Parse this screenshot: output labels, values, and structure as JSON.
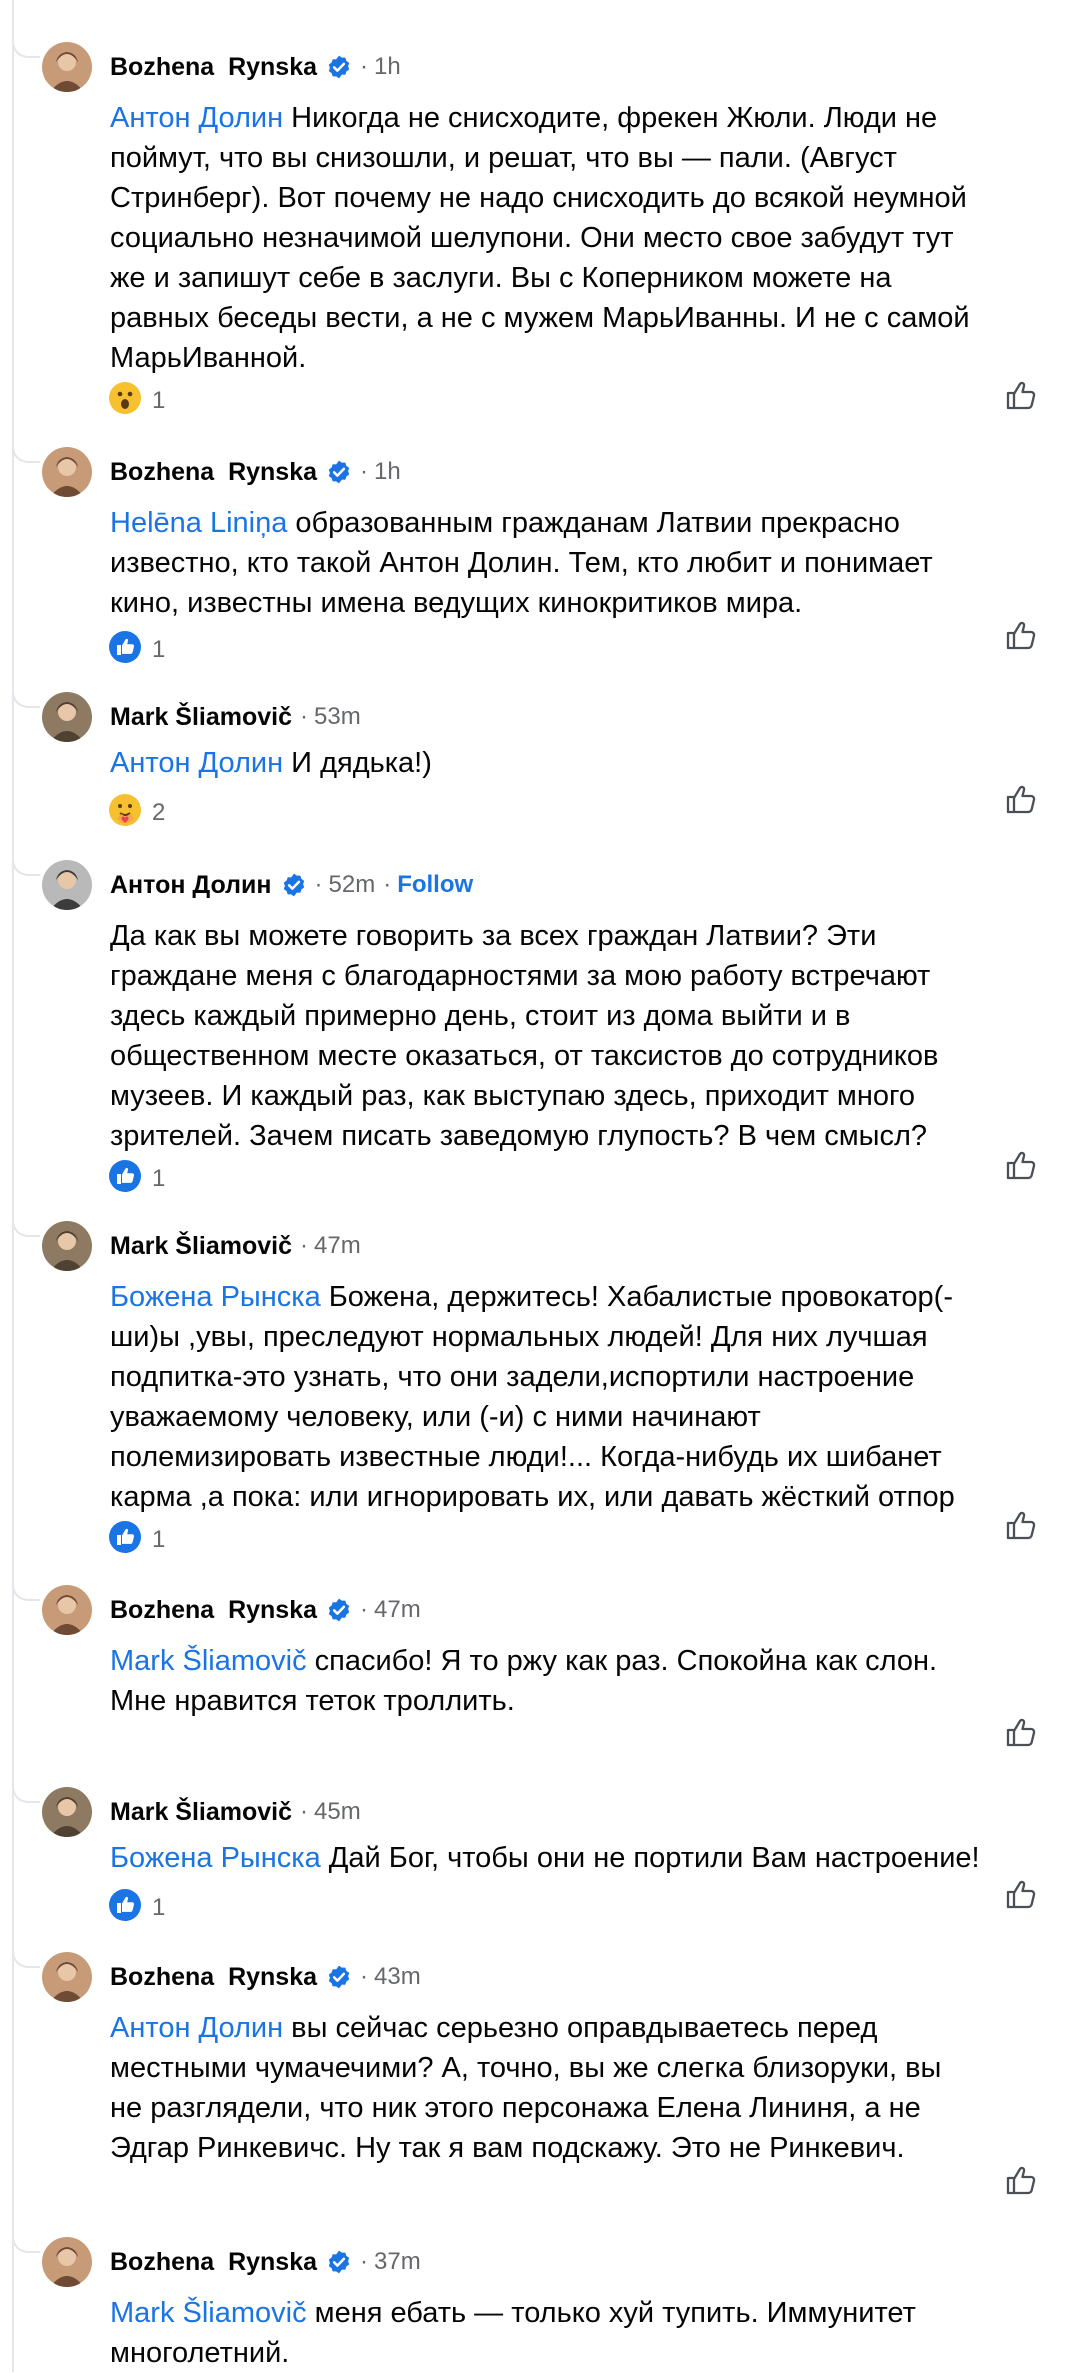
{
  "comments": [
    {
      "author": "Bozhena  Rynska",
      "verified": true,
      "time": "1h",
      "follow": "",
      "lines": [
        {
          "mention": "Антон Долин",
          "text": " Никогда не снисходите, фрекен Жюли. Люди не"
        },
        {
          "mention": "",
          "text": "поймут, что вы снизошли, и решат, что вы — пали. (Август"
        },
        {
          "mention": "",
          "text": "Стринберг). Вот почему не надо снисходить до всякой неумной"
        },
        {
          "mention": "",
          "text": "социально незначимой шелупони. Они место свое забудут тут"
        },
        {
          "mention": "",
          "text": "же и запишут себе в заслуги. Вы с Коперником можете на"
        },
        {
          "mention": "",
          "text": "равных беседы вести, а не с мужем МарьИванны. И не с самой"
        },
        {
          "mention": "",
          "text": "МарьИванной."
        }
      ],
      "reaction": {
        "type": "wow",
        "count": "1"
      }
    },
    {
      "author": "Bozhena  Rynska",
      "verified": true,
      "time": "1h",
      "follow": "",
      "lines": [
        {
          "mention": "Helēna Liniņa",
          "text": " образованным гражданам Латвии прекрасно"
        },
        {
          "mention": "",
          "text": "известно, кто такой Антон Долин. Тем, кто любит и понимает"
        },
        {
          "mention": "",
          "text": "кино, известны имена ведущих кинокритиков мира."
        }
      ],
      "reaction": {
        "type": "like",
        "count": "1"
      }
    },
    {
      "author": "Mark Šliamovič",
      "verified": false,
      "time": "53m",
      "follow": "",
      "lines": [
        {
          "mention": "Антон Долин",
          "text": " И дядька!)"
        }
      ],
      "reaction": {
        "type": "care",
        "count": "2"
      }
    },
    {
      "author": "Антон Долин",
      "verified": true,
      "time": "52m",
      "follow": "Follow",
      "lines": [
        {
          "mention": "",
          "text": "Да как вы можете говорить за всех граждан Латвии? Эти"
        },
        {
          "mention": "",
          "text": "граждане меня с благодарностями за мою работу встречают"
        },
        {
          "mention": "",
          "text": "здесь каждый примерно день, стоит из дома выйти и в"
        },
        {
          "mention": "",
          "text": "общественном месте оказаться, от таксистов до сотрудников"
        },
        {
          "mention": "",
          "text": "музеев. И каждый раз, как выступаю здесь, приходит много"
        },
        {
          "mention": "",
          "text": "зрителей. Зачем писать заведомую глупость? В чем смысл?"
        }
      ],
      "reaction": {
        "type": "like",
        "count": "1"
      }
    },
    {
      "author": "Mark Šliamovič",
      "verified": false,
      "time": "47m",
      "follow": "",
      "lines": [
        {
          "mention": "Божена Рынска",
          "text": " Божена, держитесь! Хабалистые провокатор(-"
        },
        {
          "mention": "",
          "text": "ши)ы ,увы, преследуют нормальных людей! Для них лучшая"
        },
        {
          "mention": "",
          "text": "подпитка-это узнать, что они задели,испортили настроение"
        },
        {
          "mention": "",
          "text": "уважаемому человеку, или (-и) с ними начинают"
        },
        {
          "mention": "",
          "text": "полемизировать известные люди!... Когда-нибудь их шибанет"
        },
        {
          "mention": "",
          "text": "карма ,а пока: или игнорировать их, или давать жёсткий отпор"
        }
      ],
      "reaction": {
        "type": "like",
        "count": "1"
      }
    },
    {
      "author": "Bozhena  Rynska",
      "verified": true,
      "time": "47m",
      "follow": "",
      "lines": [
        {
          "mention": "Mark Šliamovič",
          "text": " спасибо! Я то ржу как раз. Спокойна как слон."
        },
        {
          "mention": "",
          "text": "Мне нравится теток троллить."
        }
      ],
      "reaction": null
    },
    {
      "author": "Mark Šliamovič",
      "verified": false,
      "time": "45m",
      "follow": "",
      "lines": [
        {
          "mention": "Божена Рынска",
          "text": " Дай Бог, чтобы они не портили Вам настроение!"
        }
      ],
      "reaction": {
        "type": "like",
        "count": "1"
      }
    },
    {
      "author": "Bozhena  Rynska",
      "verified": true,
      "time": "43m",
      "follow": "",
      "lines": [
        {
          "mention": "Антон Долин",
          "text": " вы сейчас серьезно оправдываетесь перед"
        },
        {
          "mention": "",
          "text": "местными чумачечими? А, точно, вы же слегка близоруки, вы"
        },
        {
          "mention": "",
          "text": "не разглядели, что ник этого персонажа Елена Лининя, а не"
        },
        {
          "mention": "",
          "text": "Эдгар Ринкевичс. Ну так я вам подскажу. Это не Ринкевич."
        }
      ],
      "reaction": null
    },
    {
      "author": "Bozhena  Rynska",
      "verified": true,
      "time": "37m",
      "follow": "",
      "lines": [
        {
          "mention": "Mark Šliamovič",
          "text": " меня ебать — только хуй тупить. Иммунитет"
        },
        {
          "mention": "",
          "text": "многолетний."
        }
      ],
      "reaction": null
    }
  ],
  "colors": {
    "link": "#1b74e4",
    "meta": "#65676b",
    "line": "#e4e6eb"
  }
}
